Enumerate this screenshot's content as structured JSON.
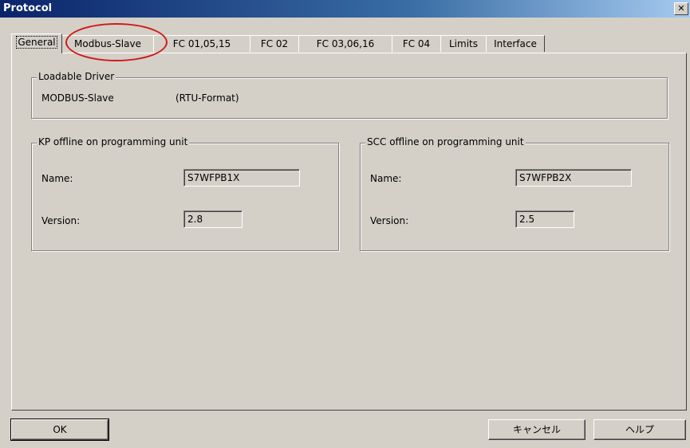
{
  "window": {
    "title": "Protocol",
    "close_label": "✕"
  },
  "tabs": [
    {
      "label": "General"
    },
    {
      "label": "Modbus-Slave"
    },
    {
      "label": "FC 01,05,15"
    },
    {
      "label": "FC 02"
    },
    {
      "label": "FC 03,06,16"
    },
    {
      "label": "FC 04"
    },
    {
      "label": "Limits"
    },
    {
      "label": "Interface"
    }
  ],
  "loadable_driver": {
    "legend": "Loadable Driver",
    "driver": "MODBUS-Slave",
    "format": "(RTU-Format)"
  },
  "kp_group": {
    "legend": "KP offline on programming unit",
    "name_label": "Name:",
    "name_value": "S7WFPB1X",
    "version_label": "Version:",
    "version_value": "2.8"
  },
  "scc_group": {
    "legend": "SCC offline on programming unit",
    "name_label": "Name:",
    "name_value": "S7WFPB2X",
    "version_label": "Version:",
    "version_value": "2.5"
  },
  "buttons": {
    "ok": "OK",
    "cancel": "キャンセル",
    "help": "ヘルプ"
  },
  "annotation_color": "#d11919"
}
